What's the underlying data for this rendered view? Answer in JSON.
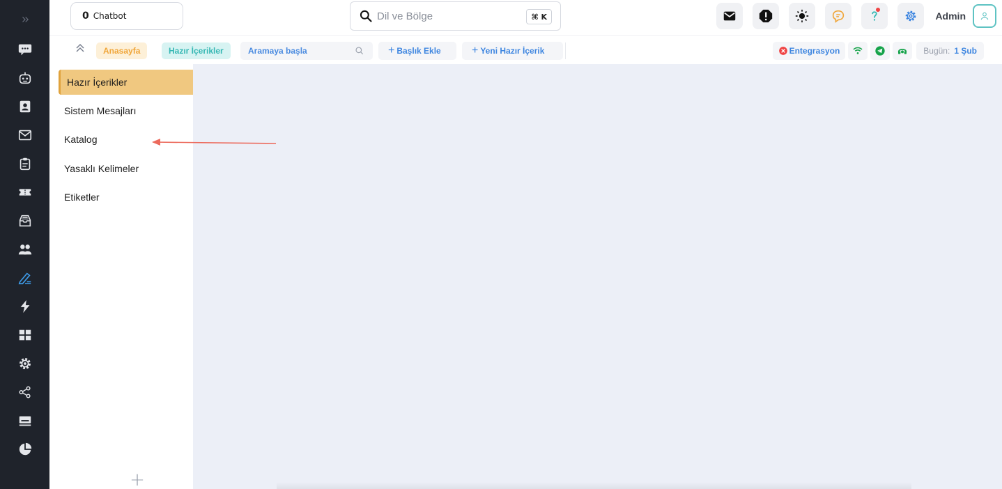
{
  "chatbot": {
    "count": "0",
    "label": "Chatbot"
  },
  "search": {
    "placeholder": "Dil ve Bölge",
    "shortcut": "⌘ K"
  },
  "user": {
    "name": "Admin"
  },
  "breadcrumb": {
    "home": "Anasayfa",
    "current": "Hazır İçerikler"
  },
  "toolbar": {
    "search_placeholder": "Aramaya başla",
    "add_title": "Başlık Ekle",
    "add_content": "Yeni Hazır İçerik",
    "integration": "Entegrasyon",
    "date_label": "Bugün:",
    "date_value": "1 Şub"
  },
  "menu": {
    "items": [
      {
        "label": "Hazır İçerikler",
        "active": true
      },
      {
        "label": "Sistem Mesajları",
        "active": false
      },
      {
        "label": "Katalog",
        "active": false
      },
      {
        "label": "Yasaklı Kelimeler",
        "active": false
      },
      {
        "label": "Etiketler",
        "active": false
      }
    ],
    "add_symbol": "+"
  },
  "colors": {
    "rail": "#1f232b",
    "accent_blue": "#3e86e0",
    "active_menu": "#f0c880",
    "home_crumb": "#f0a63a",
    "current_crumb": "#37b8b4",
    "annotation_arrow": "#ec6a5c"
  },
  "rail_icons": [
    "chat-icon",
    "bot-icon",
    "contacts-icon",
    "mail-icon",
    "clipboard-icon",
    "ticket-icon",
    "inbox-icon",
    "users-icon",
    "edit-icon",
    "flash-icon",
    "grid-icon",
    "settings-icon",
    "share-icon",
    "keyboard-icon",
    "pie-chart-icon"
  ]
}
